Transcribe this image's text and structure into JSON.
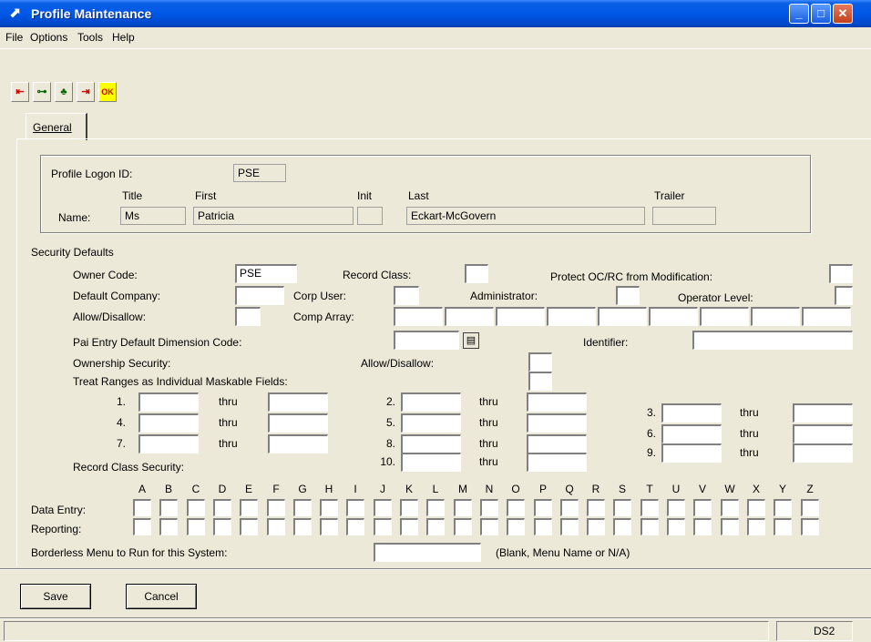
{
  "window": {
    "title": "Profile Maintenance",
    "icon": "app-arrow-icon",
    "controls": [
      "minimize-icon",
      "maximize-icon",
      "close-icon"
    ]
  },
  "menu": [
    "File",
    "Options",
    "Tools",
    "Help"
  ],
  "toolbar": [
    {
      "icon": "exit-icon"
    },
    {
      "icon": "hierarchy-icon"
    },
    {
      "icon": "tree-icon"
    },
    {
      "icon": "forward-icon"
    },
    {
      "icon": "ok-help-icon",
      "text": "OK"
    }
  ],
  "tab": {
    "label": "General"
  },
  "profile": {
    "logon_label": "Profile Logon ID:",
    "logon_value": "PSE",
    "name_label": "Name:",
    "title_header": "Title",
    "title_value": "Ms",
    "first_header": "First",
    "first_value": "Patricia",
    "init_header": "Init",
    "init_value": "",
    "last_header": "Last",
    "last_value": "Eckart-McGovern",
    "trailer_header": "Trailer",
    "trailer_value": ""
  },
  "security": {
    "section_label": "Security Defaults",
    "owner_code_label": "Owner Code:",
    "owner_code_value": "PSE",
    "record_class_label": "Record Class:",
    "protect_label": "Protect OC/RC from Modification:",
    "default_company_label": "Default Company:",
    "corp_user_label": "Corp User:",
    "administrator_label": "Administrator:",
    "operator_level_label": "Operator Level:",
    "allow_disallow_label": "Allow/Disallow:",
    "comp_array_label": "Comp Array:",
    "pai_entry_label": "Pai Entry Default Dimension Code:",
    "identifier_label": "Identifier:",
    "ownership_label": "Ownership Security:",
    "ownership_allow_label": "Allow/Disallow:",
    "treat_ranges_label": "Treat Ranges as Individual Maskable Fields:",
    "thru_label": "thru",
    "ranges": [
      "1.",
      "2.",
      "3.",
      "4.",
      "5.",
      "6.",
      "7.",
      "8.",
      "9.",
      "10."
    ],
    "record_class_security_label": "Record Class Security:"
  },
  "letters": [
    "A",
    "B",
    "C",
    "D",
    "E",
    "F",
    "G",
    "H",
    "I",
    "J",
    "K",
    "L",
    "M",
    "N",
    "O",
    "P",
    "Q",
    "R",
    "S",
    "T",
    "U",
    "V",
    "W",
    "X",
    "Y",
    "Z"
  ],
  "rows": {
    "data_entry_label": "Data Entry:",
    "reporting_label": "Reporting:"
  },
  "borderless": {
    "label": "Borderless Menu to Run for this System:",
    "hint": "(Blank, Menu Name or N/A)"
  },
  "buttons": {
    "save": "Save",
    "cancel": "Cancel"
  },
  "status": {
    "db": "DS2"
  }
}
